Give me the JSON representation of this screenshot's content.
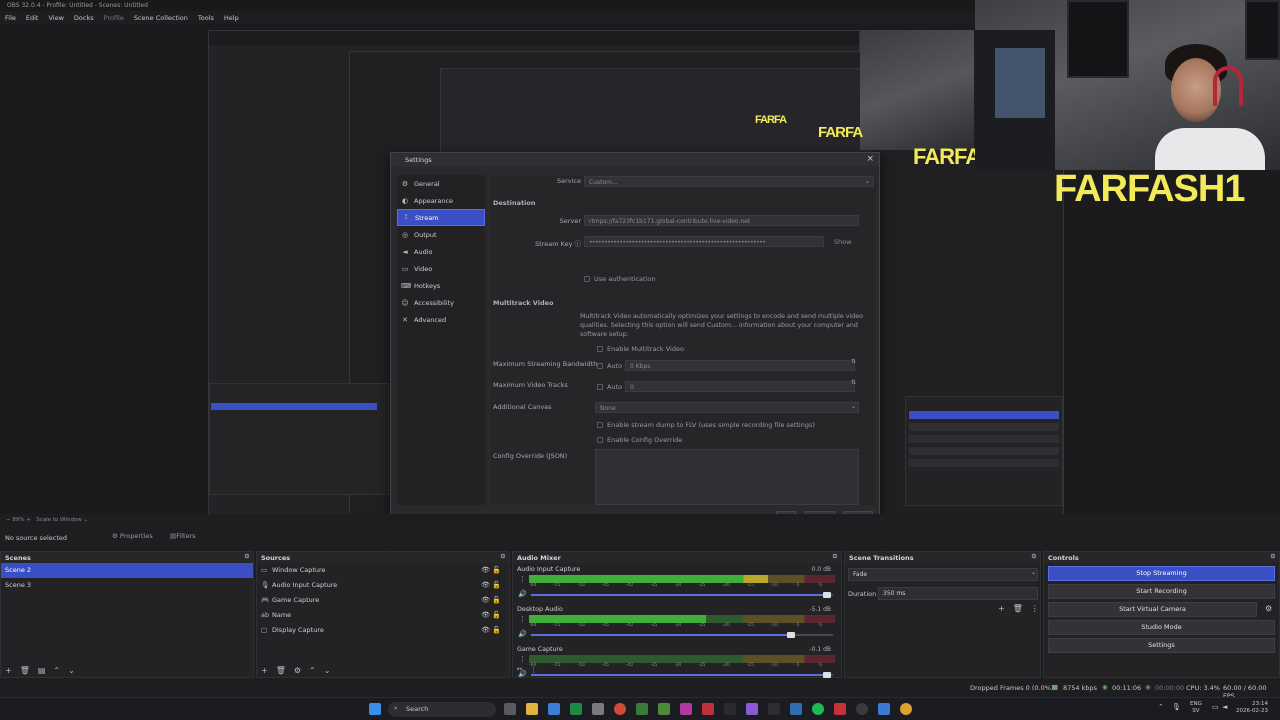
{
  "window": {
    "title": "OBS 32.0.4 - Profile: Untitled - Scenes: Untitled"
  },
  "menu": [
    "File",
    "Edit",
    "View",
    "Docks",
    "Profile",
    "Scene Collection",
    "Tools",
    "Help"
  ],
  "preview_overlay": {
    "text_large": "FARFASH1",
    "text_mid": "FARFA"
  },
  "settings": {
    "title": "Settings",
    "nav": [
      {
        "label": "General",
        "icon": "gear-icon"
      },
      {
        "label": "Appearance",
        "icon": "palette-icon"
      },
      {
        "label": "Stream",
        "icon": "antenna-icon"
      },
      {
        "label": "Output",
        "icon": "output-icon"
      },
      {
        "label": "Audio",
        "icon": "speaker-icon"
      },
      {
        "label": "Video",
        "icon": "monitor-icon"
      },
      {
        "label": "Hotkeys",
        "icon": "keyboard-icon"
      },
      {
        "label": "Accessibility",
        "icon": "accessibility-icon"
      },
      {
        "label": "Advanced",
        "icon": "wrench-icon"
      }
    ],
    "service_label": "Service",
    "service_value": "Custom...",
    "destination_title": "Destination",
    "server_label": "Server",
    "server_value": "rtmps://fa723fc1b171.global-contribute.live-video.net",
    "stream_key_label": "Stream Key",
    "stream_key_value": "••••••••••••••••••••••••••••••••••••••••••••••••••••••••••",
    "show_label": "Show",
    "use_auth_label": "Use authentication",
    "multitrack_title": "Multitrack Video",
    "multitrack_desc": "Multitrack Video automatically optimizes your settings to encode and send multiple video qualities. Selecting this option will send Custom... information about your computer and software setup.",
    "enable_multitrack_label": "Enable Multitrack Video",
    "max_bandwidth_label": "Maximum Streaming Bandwidth",
    "auto_label": "Auto",
    "bandwidth_value": "0 Kbps",
    "max_tracks_label": "Maximum Video Tracks",
    "tracks_value": "0",
    "additional_canvas_label": "Additional Canvas",
    "canvas_value": "None",
    "flv_dump_label": "Enable stream dump to FLV (uses simple recording file settings)",
    "config_override_check_label": "Enable Config Override",
    "config_override_label": "Config Override (JSON)",
    "ok_label": "OK",
    "cancel_label": "Cancel",
    "apply_label": "Apply"
  },
  "toolbar": {
    "zoom": "89%",
    "scale": "Scale to Window",
    "no_source": "No source selected",
    "properties": "Properties",
    "filters": "Filters"
  },
  "scenes": {
    "title": "Scenes",
    "items": [
      "Scene 2",
      "Scene 3"
    ]
  },
  "sources": {
    "title": "Sources",
    "items": [
      {
        "label": "Window Capture",
        "icon": "window-icon"
      },
      {
        "label": "Audio Input Capture",
        "icon": "microphone-icon"
      },
      {
        "label": "Game Capture",
        "icon": "gamepad-icon"
      },
      {
        "label": "Name",
        "icon": "text-icon"
      },
      {
        "label": "Display Capture",
        "icon": "display-icon"
      }
    ]
  },
  "mixer": {
    "title": "Audio Mixer",
    "channels": [
      {
        "name": "Audio Input Capture",
        "db": "0.0 dB",
        "level": 0.78,
        "fader": 0.98
      },
      {
        "name": "Desktop Audio",
        "db": "-5.1 dB",
        "level": 0.58,
        "fader": 0.86
      },
      {
        "name": "Game Capture",
        "db": "-0.1 dB",
        "level": 0.0,
        "fader": 0.98
      }
    ],
    "scale": [
      "-60",
      "-55",
      "-50",
      "-45",
      "-40",
      "-35",
      "-30",
      "-25",
      "-20",
      "-15",
      "-10",
      "-5",
      "0"
    ]
  },
  "transitions": {
    "title": "Scene Transitions",
    "value": "Fade",
    "duration_label": "Duration",
    "duration_value": "350 ms"
  },
  "controls": {
    "title": "Controls",
    "buttons": [
      "Stop Streaming",
      "Start Recording",
      "Start Virtual Camera",
      "Studio Mode",
      "Settings"
    ]
  },
  "status": {
    "dropped": "Dropped Frames 0 (0.0%)",
    "bitrate": "8754 kbps",
    "live_time": "00:11:06",
    "rec_time": "00:00:00",
    "cpu": "CPU: 3.4%",
    "fps": "60.00 / 60.00 FPS"
  },
  "taskbar": {
    "search": "Search",
    "lang": "ENG",
    "lang2": "SV",
    "time": "23:14",
    "date": "2026-02-23"
  },
  "colors": {
    "accent": "#3b4fc4",
    "meter_green": "#3fae3a",
    "meter_yellow": "#b9a82b",
    "meter_red": "#b3283a"
  }
}
